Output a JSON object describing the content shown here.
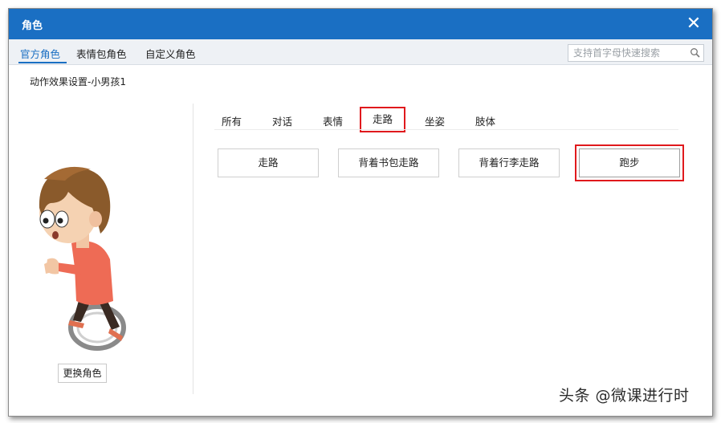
{
  "window": {
    "title": "角色",
    "close_label": "✕"
  },
  "top_tabs": [
    {
      "label": "官方角色",
      "active": true
    },
    {
      "label": "表情包角色",
      "active": false
    },
    {
      "label": "自定义角色",
      "active": false
    }
  ],
  "search": {
    "placeholder": "支持首字母快速搜索"
  },
  "subtitle": "动作效果设置-小男孩1",
  "change_role_label": "更换角色",
  "category_tabs": [
    {
      "label": "所有",
      "active": false
    },
    {
      "label": "对话",
      "active": false
    },
    {
      "label": "表情",
      "active": false
    },
    {
      "label": "走路",
      "active": true
    },
    {
      "label": "坐姿",
      "active": false
    },
    {
      "label": "肢体",
      "active": false
    }
  ],
  "motions": [
    {
      "label": "走路",
      "highlight": false
    },
    {
      "label": "背着书包走路",
      "highlight": false
    },
    {
      "label": "背着行李走路",
      "highlight": false
    },
    {
      "label": "跑步",
      "highlight": true
    }
  ],
  "watermark": "头条 @微课进行时",
  "colors": {
    "accent": "#1a6fc3",
    "highlight": "#e0191d"
  }
}
